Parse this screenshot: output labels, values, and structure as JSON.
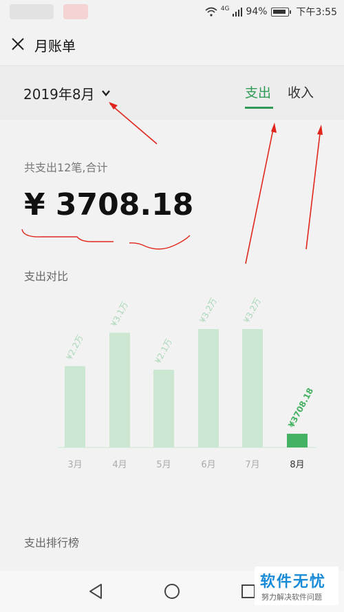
{
  "status_bar": {
    "network": "4G",
    "battery_percent": "94%",
    "time": "下午3:55"
  },
  "header": {
    "title": "月账单",
    "close_icon": "close-icon"
  },
  "filter": {
    "month": "2019年8月",
    "tabs": [
      {
        "label": "支出",
        "active": true
      },
      {
        "label": "收入",
        "active": false
      }
    ]
  },
  "summary": {
    "label": "共支出12笔,合计",
    "amount": "¥ 3708.18"
  },
  "sections": {
    "comparison": "支出对比",
    "ranking": "支出排行榜"
  },
  "colors": {
    "accent": "#2e9a55",
    "bar_light": "#cbe7d2",
    "bar_active": "#45b163",
    "annotation_red": "#e0261c"
  },
  "chart_data": {
    "type": "bar",
    "categories": [
      "3月",
      "4月",
      "5月",
      "6月",
      "7月",
      "8月"
    ],
    "values": [
      22000,
      31000,
      21000,
      32000,
      32000,
      3708.18
    ],
    "data_labels": [
      "¥2.2万",
      "¥3.1万",
      "¥2.1万",
      "¥3.2万",
      "¥3.2万",
      "¥3708.18"
    ],
    "highlight_index": 5,
    "ylim": [
      0,
      32000
    ]
  },
  "watermark": {
    "main": "软件无忧",
    "sub": "努力解决软件问题"
  }
}
